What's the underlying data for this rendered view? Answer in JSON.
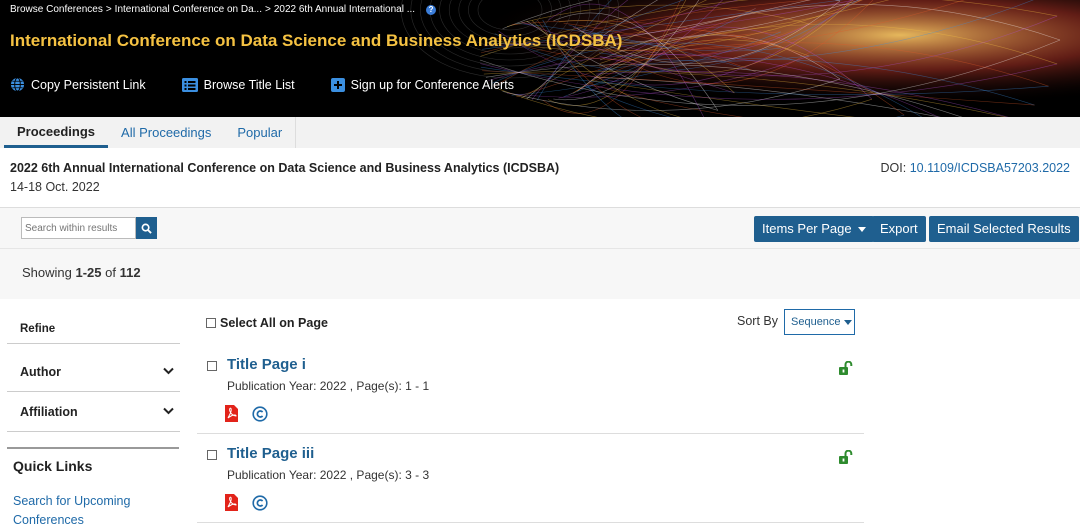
{
  "breadcrumb": {
    "items": [
      "Browse Conferences",
      "International Conference on Da...",
      "2022 6th Annual International ..."
    ],
    "separator": ">"
  },
  "header": {
    "title": "International Conference on Data Science and Business Analytics (ICDSBA)",
    "title_color": "#f5c242",
    "actions": {
      "copy_link": "Copy Persistent Link",
      "browse_title": "Browse Title List",
      "alerts": "Sign up for Conference Alerts"
    }
  },
  "tabs": [
    "Proceedings",
    "All Proceedings",
    "Popular"
  ],
  "proceedings": {
    "title": "2022 6th Annual International Conference on Data Science and Business Analytics (ICDSBA)",
    "date": "14-18 Oct. 2022",
    "doi_label": "DOI:",
    "doi_value": "10.1109/ICDSBA57203.2022"
  },
  "toolbar": {
    "search_placeholder": "Search within results",
    "items_per_page": "Items Per Page",
    "export": "Export",
    "email": "Email Selected Results"
  },
  "showing": {
    "prefix": "Showing",
    "range": "1-25",
    "of": "of",
    "total": "112"
  },
  "sidebar": {
    "refine": "Refine",
    "facets": [
      "Author",
      "Affiliation"
    ],
    "quick_links_title": "Quick Links",
    "quick_links": [
      "Search for Upcoming Conferences"
    ]
  },
  "results_header": {
    "select_all": "Select All on Page",
    "sort_by": "Sort By",
    "sort_value": "Sequence"
  },
  "results": [
    {
      "title": "Title Page i",
      "meta": "Publication Year: 2022 , Page(s): 1  -  1"
    },
    {
      "title": "Title Page iii",
      "meta": "Publication Year: 2022 , Page(s): 3  -  3"
    }
  ],
  "colors": {
    "primary": "#1f5f8f",
    "link": "#1f6aa8",
    "pdf": "#e2231a",
    "lock": "#2e8b2e"
  }
}
